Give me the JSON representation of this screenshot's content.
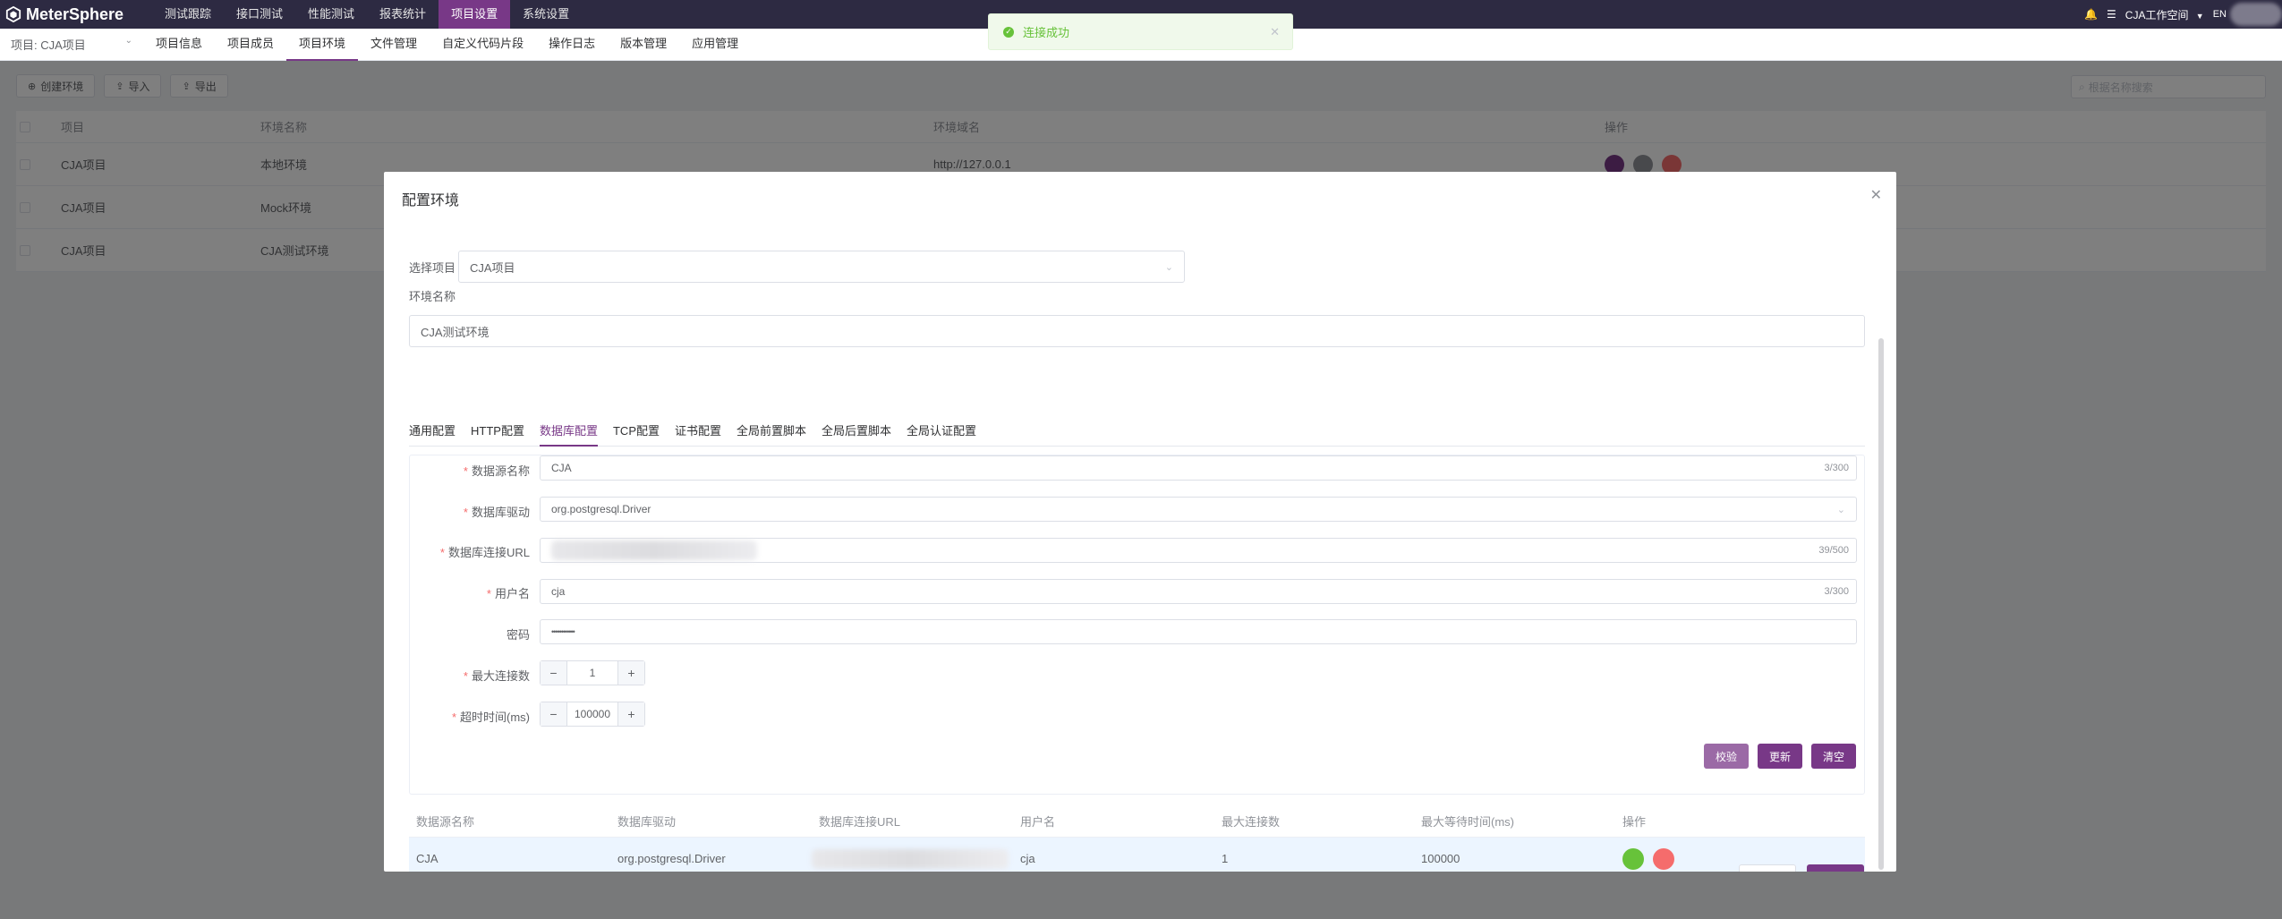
{
  "topnav": {
    "logo": "MeterSphere",
    "items": [
      {
        "label": "测试跟踪"
      },
      {
        "label": "接口测试"
      },
      {
        "label": "性能测试"
      },
      {
        "label": "报表统计"
      },
      {
        "label": "项目设置"
      },
      {
        "label": "系统设置"
      }
    ],
    "workspace": "CJA工作空间",
    "lang": "EN"
  },
  "subnav": {
    "project": "项目: CJA项目",
    "items": [
      {
        "label": "项目信息"
      },
      {
        "label": "项目成员"
      },
      {
        "label": "项目环境"
      },
      {
        "label": "文件管理"
      },
      {
        "label": "自定义代码片段"
      },
      {
        "label": "操作日志"
      },
      {
        "label": "版本管理"
      },
      {
        "label": "应用管理"
      }
    ]
  },
  "toolbar": {
    "create": "创建环境",
    "import": "导入",
    "export": "导出",
    "search_placeholder": "根据名称搜索"
  },
  "env_table": {
    "headers": [
      "项目",
      "环境名称",
      "环境域名",
      "操作"
    ],
    "rows": [
      {
        "project": "CJA项目",
        "name": "本地环境",
        "domain": "http://127.0.0.1"
      },
      {
        "project": "CJA项目",
        "name": "Mock环境",
        "domain": ""
      },
      {
        "project": "CJA项目",
        "name": "CJA测试环境",
        "domain": ""
      }
    ]
  },
  "toast": {
    "message": "连接成功"
  },
  "dialog": {
    "title": "配置环境",
    "select_project_label": "选择项目",
    "select_project_value": "CJA项目",
    "env_name_label": "环境名称",
    "env_name_value": "CJA测试环境",
    "tabs": [
      {
        "label": "通用配置"
      },
      {
        "label": "HTTP配置"
      },
      {
        "label": "数据库配置"
      },
      {
        "label": "TCP配置"
      },
      {
        "label": "证书配置"
      },
      {
        "label": "全局前置脚本"
      },
      {
        "label": "全局后置脚本"
      },
      {
        "label": "全局认证配置"
      }
    ],
    "form": {
      "ds_name_label": "数据源名称",
      "ds_name_value": "CJA",
      "ds_name_count": "3/300",
      "driver_label": "数据库驱动",
      "driver_value": "org.postgresql.Driver",
      "url_label": "数据库连接URL",
      "url_count": "39/500",
      "user_label": "用户名",
      "user_value": "cja",
      "user_count": "3/300",
      "password_label": "密码",
      "password_value": "••••••••••••",
      "max_conn_label": "最大连接数",
      "max_conn_value": "1",
      "timeout_label": "超时时间(ms)",
      "timeout_value": "100000",
      "stepper_minus": "−",
      "stepper_plus": "+",
      "check_btn": "校验",
      "update_btn": "更新",
      "clear_btn": "清空"
    },
    "result_table": {
      "headers": [
        "数据源名称",
        "数据库驱动",
        "数据库连接URL",
        "用户名",
        "最大连接数",
        "最大等待时间(ms)",
        "操作"
      ],
      "row": {
        "name": "CJA",
        "driver": "org.postgresql.Driver",
        "user": "cja",
        "max_conn": "1",
        "max_wait": "100000"
      }
    }
  },
  "colors": {
    "primary": "#783887",
    "nav_bg": "#2d2a42",
    "success": "#67c23a",
    "danger": "#f56c6c"
  }
}
